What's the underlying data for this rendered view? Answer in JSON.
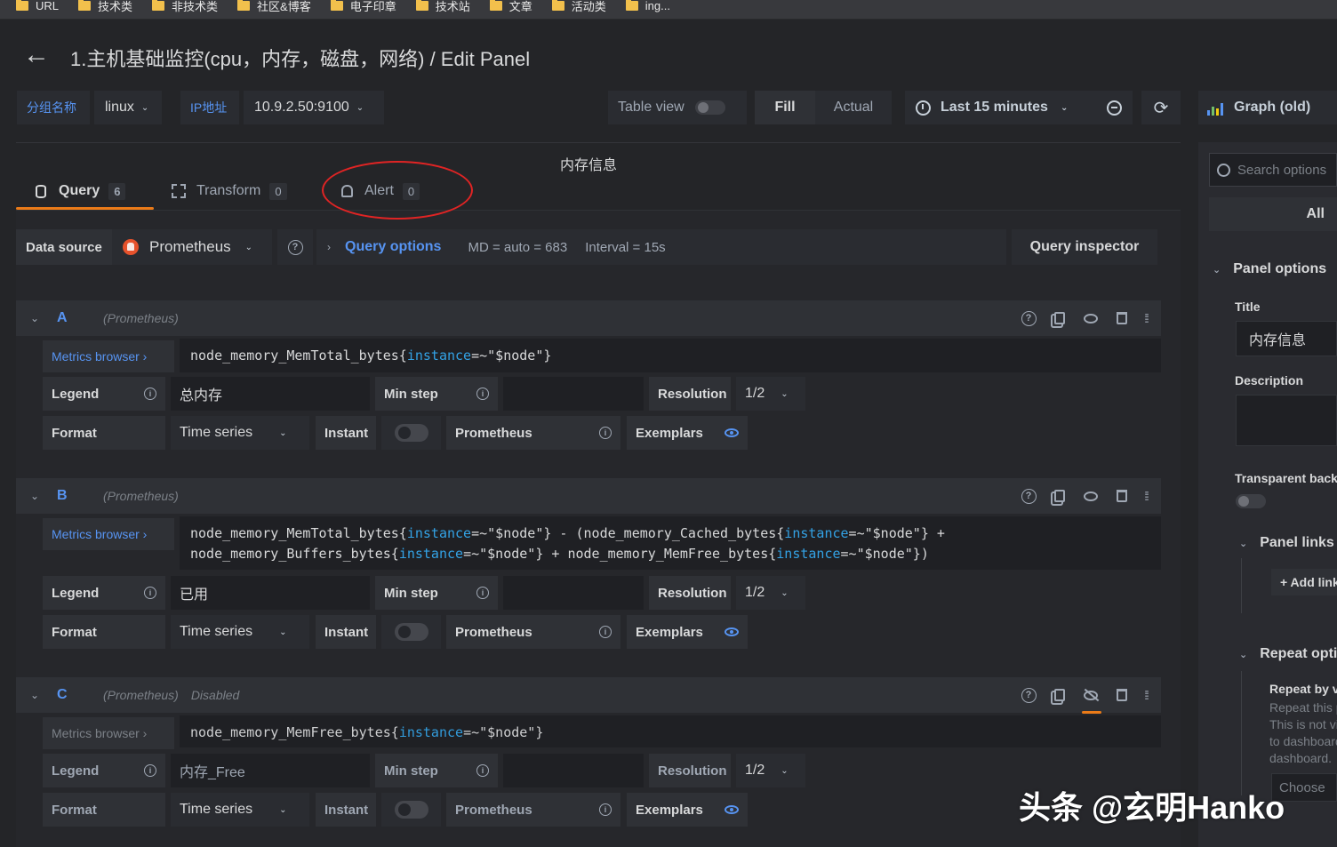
{
  "bookmarks": [
    "URL",
    "技术类",
    "非技术类",
    "社区&博客",
    "电子印章",
    "技术站",
    "文章",
    "活动类",
    "ing..."
  ],
  "header": {
    "title": "1.主机基础监控(cpu，内存，磁盘，网络) / Edit Panel"
  },
  "variables": [
    {
      "label": "分组名称",
      "value": "linux"
    },
    {
      "label": "IP地址",
      "value": "10.9.2.50:9100"
    }
  ],
  "toolbar": {
    "table_view": "Table view",
    "fill": "Fill",
    "actual": "Actual",
    "time_range": "Last 15 minutes",
    "visualization": "Graph (old)"
  },
  "preview": {
    "panel_title": "内存信息"
  },
  "tabs": [
    {
      "label": "Query",
      "count": "6"
    },
    {
      "label": "Transform",
      "count": "0"
    },
    {
      "label": "Alert",
      "count": "0"
    }
  ],
  "datasource": {
    "label": "Data source",
    "value": "Prometheus",
    "query_options": "Query options",
    "md": "MD = auto = 683",
    "interval": "Interval = 15s",
    "inspector": "Query inspector"
  },
  "queries": [
    {
      "ref": "A",
      "ds": "(Prometheus)",
      "status": "",
      "metrics_browser": "Metrics browser ›",
      "expr_lines": [
        [
          {
            "t": "node_memory_MemTotal_bytes{",
            "c": "op"
          },
          {
            "t": "instance",
            "c": "kw"
          },
          {
            "t": "=~\"$node\"}",
            "c": "op"
          }
        ]
      ],
      "legend_label": "Legend",
      "legend": "总内存",
      "min_step_label": "Min step",
      "resolution_label": "Resolution",
      "resolution": "1/2",
      "format_label": "Format",
      "format": "Time series",
      "instant_label": "Instant",
      "type_label": "Prometheus",
      "exemplars_label": "Exemplars"
    },
    {
      "ref": "B",
      "ds": "(Prometheus)",
      "status": "",
      "metrics_browser": "Metrics browser ›",
      "expr_lines": [
        [
          {
            "t": "node_memory_MemTotal_bytes{",
            "c": "op"
          },
          {
            "t": "instance",
            "c": "kw"
          },
          {
            "t": "=~\"$node\"} - (node_memory_Cached_bytes{",
            "c": "op"
          },
          {
            "t": "instance",
            "c": "kw"
          },
          {
            "t": "=~\"$node\"} +",
            "c": "op"
          }
        ],
        [
          {
            "t": "node_memory_Buffers_bytes{",
            "c": "op"
          },
          {
            "t": "instance",
            "c": "kw"
          },
          {
            "t": "=~\"$node\"} + node_memory_MemFree_bytes{",
            "c": "op"
          },
          {
            "t": "instance",
            "c": "kw"
          },
          {
            "t": "=~\"$node\"})",
            "c": "op"
          }
        ]
      ],
      "legend_label": "Legend",
      "legend": "已用",
      "min_step_label": "Min step",
      "resolution_label": "Resolution",
      "resolution": "1/2",
      "format_label": "Format",
      "format": "Time series",
      "instant_label": "Instant",
      "type_label": "Prometheus",
      "exemplars_label": "Exemplars"
    },
    {
      "ref": "C",
      "ds": "(Prometheus)",
      "status": "Disabled",
      "metrics_browser": "Metrics browser ›",
      "expr_lines": [
        [
          {
            "t": "node_memory_MemFree_bytes{",
            "c": "op"
          },
          {
            "t": "instance",
            "c": "kw"
          },
          {
            "t": "=~\"$node\"}",
            "c": "op"
          }
        ]
      ],
      "legend_label": "Legend",
      "legend": "内存_Free",
      "min_step_label": "Min step",
      "resolution_label": "Resolution",
      "resolution": "1/2",
      "format_label": "Format",
      "format": "Time series",
      "instant_label": "Instant",
      "type_label": "Prometheus",
      "exemplars_label": "Exemplars"
    }
  ],
  "sidebar": {
    "search_placeholder": "Search options",
    "all": "All",
    "panel_options": "Panel options",
    "title_label": "Title",
    "title_value": "内存信息",
    "description_label": "Description",
    "transparent_label": "Transparent background",
    "panel_links": "Panel links",
    "add_link": "+ Add link",
    "repeat_options": "Repeat options",
    "repeat_by": "Repeat by variable",
    "repeat_text": [
      "Repeat this panel for each value in the selected variable.",
      "This is not visible while in edit mode. You need to go back",
      "to dashboard and then update the variable or reload the",
      "dashboard."
    ],
    "choose": "Choose"
  },
  "watermark": "头条 @玄明Hanko",
  "colors": {
    "accent": "#5794f2",
    "tab_active": "#eb7b18",
    "annotation": "#e02424",
    "prometheus": "#e6522c"
  }
}
